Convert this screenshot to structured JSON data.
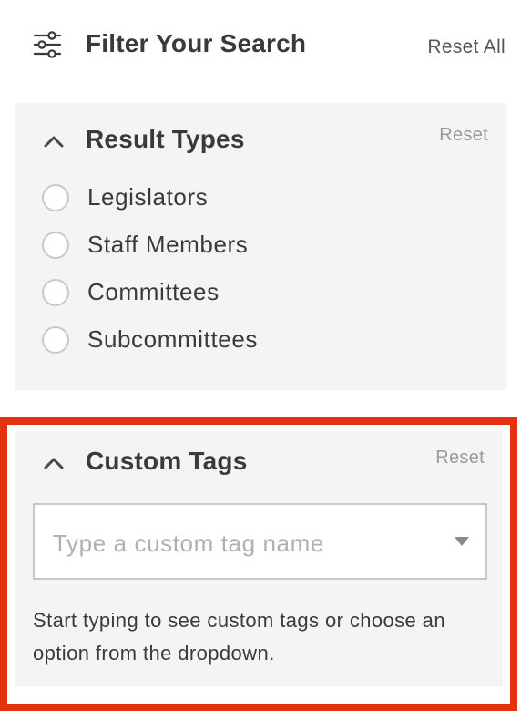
{
  "header": {
    "title": "Filter Your Search",
    "reset_all_label": "Reset All",
    "icon": "filter-sliders-icon"
  },
  "result_types": {
    "title": "Result Types",
    "reset_label": "Reset",
    "options": [
      {
        "label": "Legislators",
        "checked": false
      },
      {
        "label": "Staff Members",
        "checked": false
      },
      {
        "label": "Committees",
        "checked": false
      },
      {
        "label": "Subcommittees",
        "checked": false
      }
    ]
  },
  "custom_tags": {
    "title": "Custom Tags",
    "reset_label": "Reset",
    "input_value": "",
    "input_placeholder": "Type a custom tag name",
    "helper_text": "Start typing to see custom tags or choose an option from the dropdown.",
    "highlight_color": "#e2330e"
  },
  "colors": {
    "panel_bg": "#f4f4f4",
    "text": "#3a3a3a",
    "muted": "#9a9a9a"
  }
}
